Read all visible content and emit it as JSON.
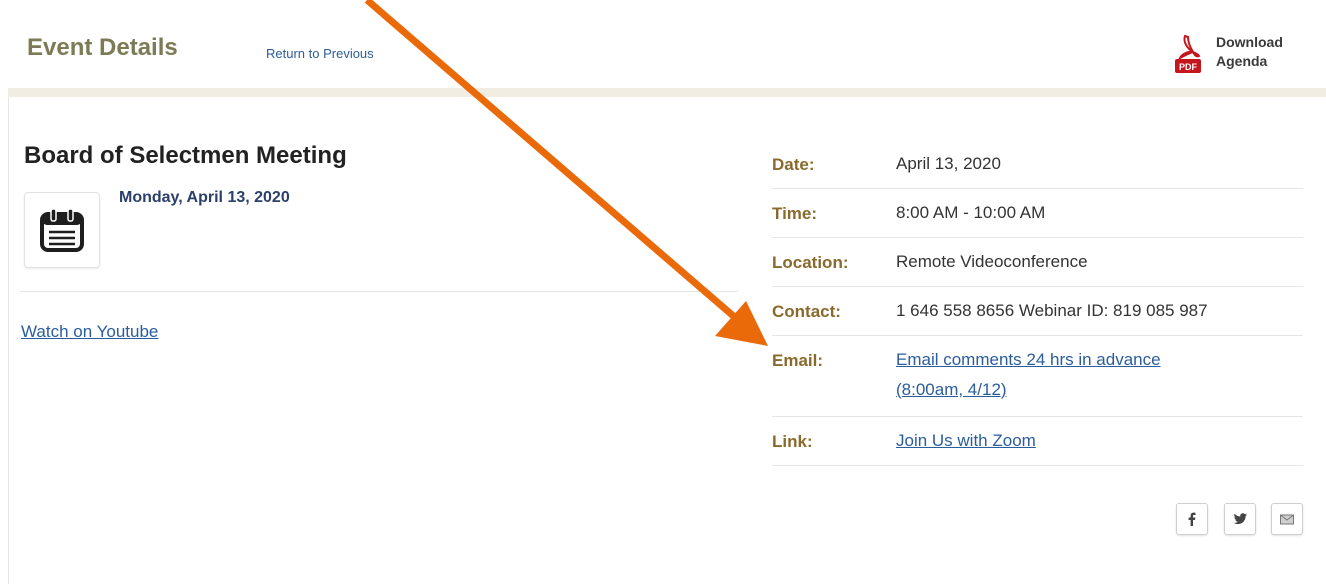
{
  "header": {
    "title": "Event Details",
    "return_link": "Return to Previous",
    "download_line1": "Download",
    "download_line2": "Agenda",
    "pdf_label": "PDF"
  },
  "event": {
    "title": "Board of Selectmen Meeting",
    "date_long": "Monday, April 13, 2020",
    "youtube_link": "Watch on Youtube"
  },
  "details": {
    "date_label": "Date:",
    "date_value": "April 13, 2020",
    "time_label": "Time:",
    "time_value": "8:00 AM - 10:00 AM",
    "location_label": "Location:",
    "location_value": "Remote Videoconference",
    "contact_label": "Contact:",
    "contact_value": "1 646 558 8656 Webinar ID: 819 085 987",
    "email_label": "Email:",
    "email_value_line1": "Email comments 24 hrs in advance",
    "email_value_line2": "(8:00am, 4/12)",
    "link_label": "Link:",
    "link_value": "Join Us with Zoom"
  },
  "share_icons": [
    "facebook-icon",
    "twitter-icon",
    "email-icon"
  ],
  "colors": {
    "header_title": "#7c7b55",
    "link": "#2b5d9c",
    "label": "#8a6a2c",
    "arrow": "#ea6a0a"
  }
}
